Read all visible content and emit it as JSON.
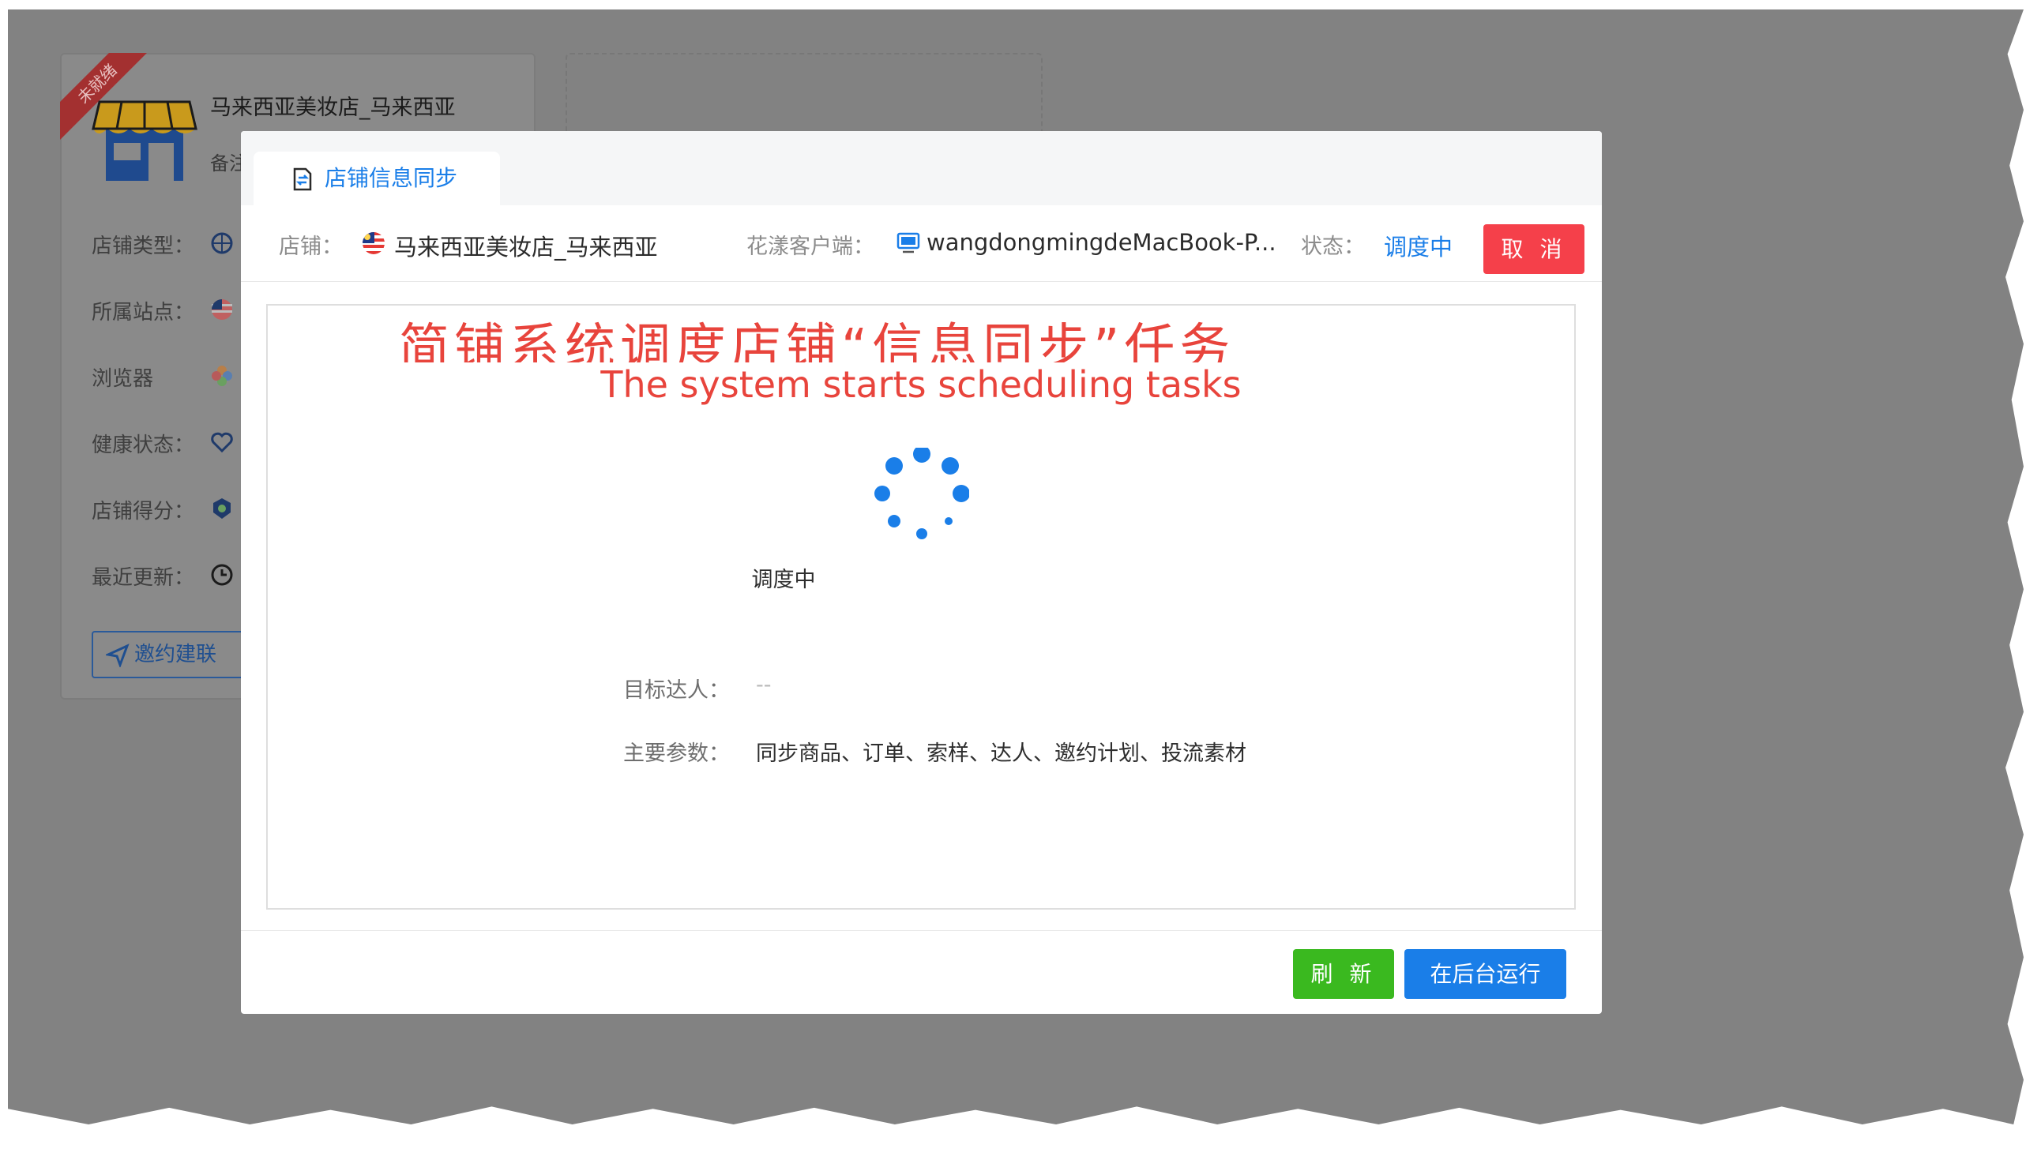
{
  "background": {
    "card": {
      "badge": "未就绪",
      "store_name": "马来西亚美妆店_马来西亚",
      "note_label": "备注",
      "rows": [
        {
          "label": "店铺类型：",
          "icon": "globe-icon"
        },
        {
          "label": "所属站点：",
          "icon": "malaysia-flag-icon"
        },
        {
          "label": "浏览器",
          "icon": "flower-icon"
        },
        {
          "label": "健康状态：",
          "icon": "heart-icon"
        },
        {
          "label": "店铺得分：",
          "icon": "medal-icon"
        },
        {
          "label": "最近更新：",
          "icon": "clock-icon"
        }
      ],
      "invite_button": "邀约建联"
    }
  },
  "modal": {
    "tab_label": "店铺信息同步",
    "store_label": "店铺：",
    "store_name": "马来西亚美妆店_马来西亚",
    "client_label": "花漾客户端：",
    "client_name": "wangdongmingdeMacBook-P...",
    "status_label": "状态：",
    "status_value": "调度中",
    "cancel_button": "取 消",
    "overlay_cn": "简铺系统调度店铺“信息同步”任务",
    "overlay_en": "The system starts scheduling tasks",
    "spinner_label": "调度中",
    "target_label": "目标达人：",
    "target_value": "--",
    "params_label": "主要参数：",
    "params_value": "同步商品、订单、索样、达人、邀约计划、投流素材",
    "refresh_button": "刷 新",
    "background_button": "在后台运行"
  },
  "colors": {
    "primary": "#1a7ee8",
    "danger": "#f5404a",
    "success": "#3ab91f",
    "overlay_text": "#e8443c"
  }
}
